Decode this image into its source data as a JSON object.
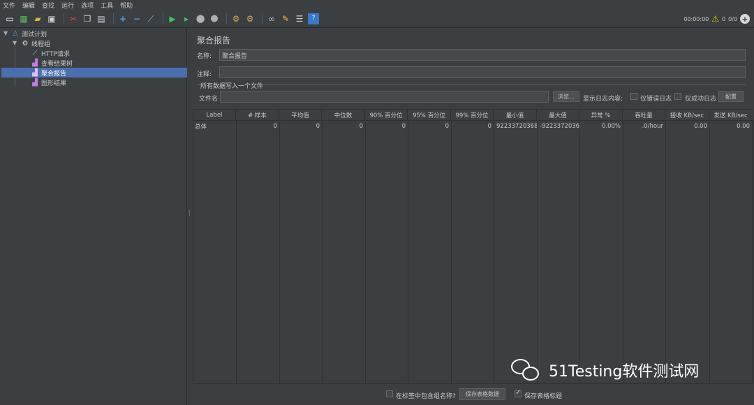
{
  "menu": [
    "文件",
    "编辑",
    "查找",
    "运行",
    "选项",
    "工具",
    "帮助"
  ],
  "toolbar": {
    "timer": "00:00:00",
    "warnings": "0",
    "threads": "0/0"
  },
  "tree": {
    "items": [
      {
        "label": "测试计划",
        "icon": "test-plan-icon"
      },
      {
        "label": "线程组",
        "icon": "gear-icon"
      },
      {
        "label": "HTTP请求",
        "icon": "sampler-icon"
      },
      {
        "label": "查看结果树",
        "icon": "listener-icon"
      },
      {
        "label": "聚合报告",
        "icon": "listener-icon"
      },
      {
        "label": "图形结果",
        "icon": "listener-icon"
      }
    ]
  },
  "panel": {
    "title": "聚合报告",
    "name_label": "名称:",
    "name_value": "聚合报告",
    "comment_label": "注释:",
    "comment_value": "",
    "file_group_label": "所有数据写入一个文件",
    "file_label": "文件名",
    "file_value": "",
    "browse_button": "浏览...",
    "log_label": "显示日志内容:",
    "errors_only": "仅错误日志",
    "success_only": "仅成功日志",
    "configure_button": "配置"
  },
  "table": {
    "headers": [
      "Label",
      "# 样本",
      "平均值",
      "中位数",
      "90% 百分位",
      "95% 百分位",
      "99% 百分位",
      "最小值",
      "最大值",
      "异常 %",
      "吞吐量",
      "接收 KB/sec",
      "发送 KB/sec"
    ],
    "rows": [
      [
        "总体",
        "0",
        "0",
        "0",
        "0",
        "0",
        "0",
        "92233720368...",
        "-9223372036...",
        "0.00%",
        ".0/hour",
        "0.00",
        "0.00"
      ]
    ]
  },
  "bottom": {
    "include_group": "在标签中包含组名称?",
    "save_table_data": "保存表格数据",
    "save_table_header": "保存表格标题"
  },
  "watermark": "51Testing软件测试网"
}
